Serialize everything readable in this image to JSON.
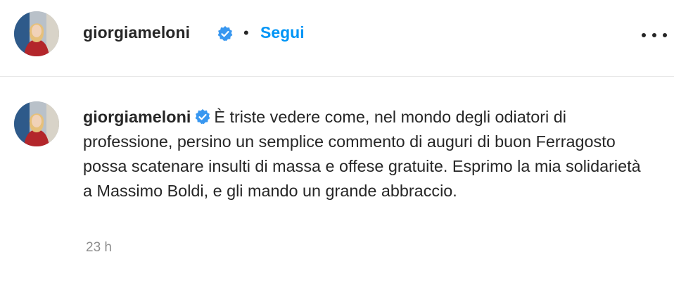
{
  "header": {
    "username": "giorgiameloni",
    "separator": "•",
    "follow_label": "Segui",
    "more_icon": "more-horizontal-icon"
  },
  "comment": {
    "username": "giorgiameloni",
    "text": "È triste vedere come, nel mondo degli odiatori di professione, persino un semplice commento di auguri di buon Ferragosto possa scatenare insulti di massa e offese gratuite. Esprimo la mia solidarietà a Massimo Boldi, e gli mando un grande abbraccio.",
    "timestamp": "23 h"
  },
  "colors": {
    "accent": "#0095f6",
    "verified": "#3897f0",
    "text": "#262626",
    "muted": "#8e8e8e",
    "divider": "#e6e6e6"
  }
}
